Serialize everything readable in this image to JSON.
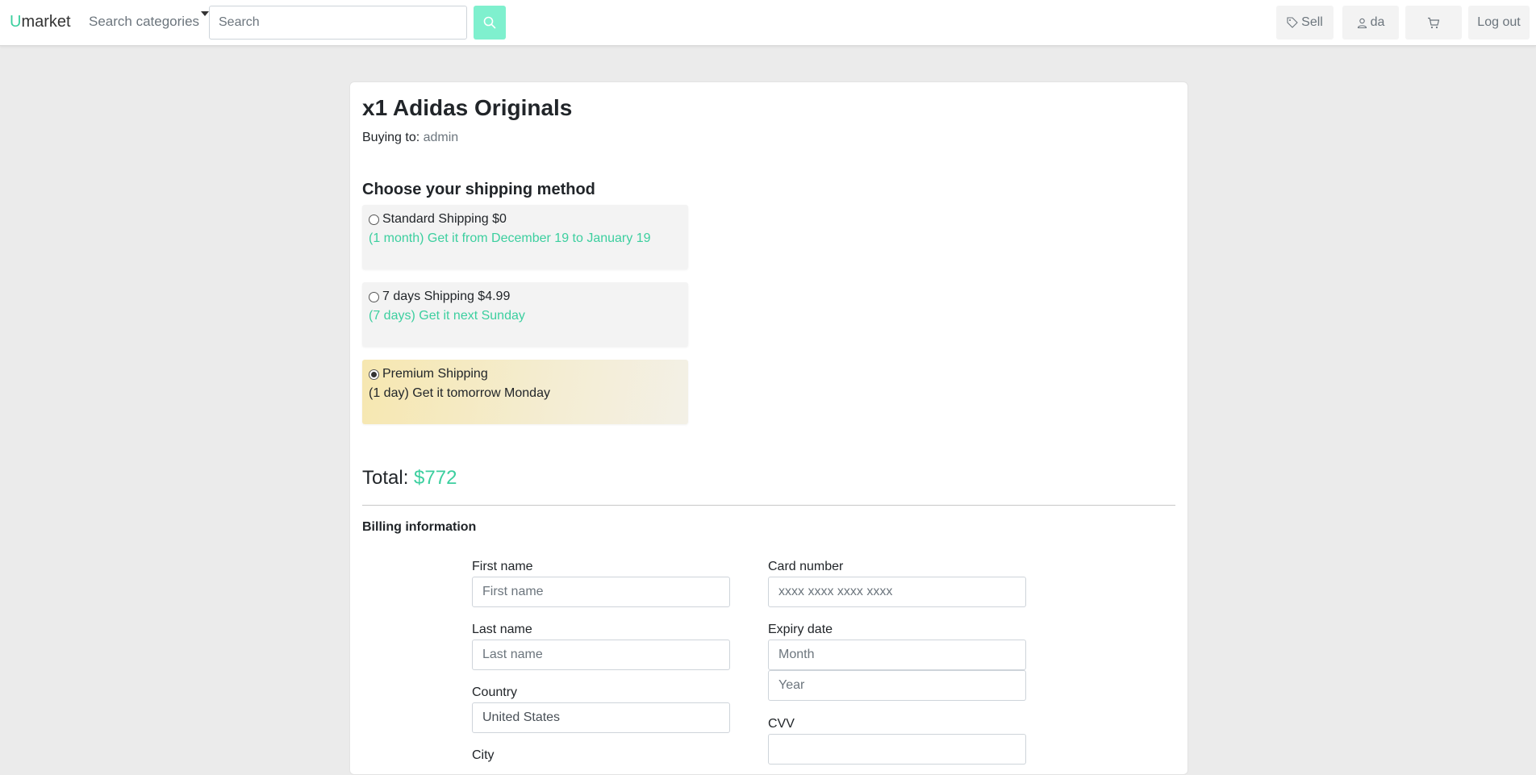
{
  "navbar": {
    "brand_first": "U",
    "brand_rest": "market",
    "categories_label": "Search categories",
    "search_placeholder": "Search",
    "sell_label": "Sell",
    "user_label": "da",
    "logout_label": "Log out"
  },
  "order": {
    "title": "x1 Adidas Originals",
    "buying_to_label": "Buying to:",
    "buying_to_user": "admin"
  },
  "shipping": {
    "heading": "Choose your shipping method",
    "options": [
      {
        "name": "Standard Shipping $0",
        "detail": "(1 month) Get it from December 19 to January 19",
        "selected": false
      },
      {
        "name": "7 days Shipping $4.99",
        "detail": "(7 days) Get it next Sunday",
        "selected": false
      },
      {
        "name": "Premium Shipping",
        "detail": "(1 day) Get it tomorrow Monday",
        "selected": true
      }
    ]
  },
  "total": {
    "label": "Total:",
    "amount": "$772"
  },
  "billing": {
    "heading": "Billing information",
    "first_name_label": "First name",
    "first_name_placeholder": "First name",
    "last_name_label": "Last name",
    "last_name_placeholder": "Last name",
    "country_label": "Country",
    "country_value": "United States",
    "city_label": "City",
    "card_number_label": "Card number",
    "card_number_placeholder": "xxxx xxxx xxxx xxxx",
    "expiry_label": "Expiry date",
    "month_placeholder": "Month",
    "year_placeholder": "Year",
    "cvv_label": "CVV"
  },
  "colors": {
    "accent": "#3ccf9f",
    "search_button": "#7ff0ce",
    "selected_option": "#f6e7b0"
  }
}
